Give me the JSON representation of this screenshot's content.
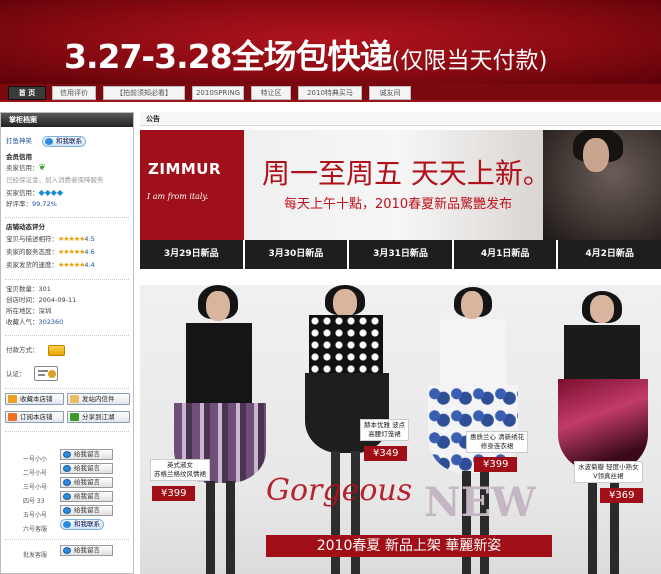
{
  "banner": {
    "title": "3.27-3.28全场包快递",
    "subtitle": "(仅限当天付款)"
  },
  "tabs": [
    {
      "label": "首 页",
      "active": true
    },
    {
      "label": "信用评价",
      "active": false
    },
    {
      "label": "【拍前须知必看】",
      "active": false
    },
    {
      "label": "2010SPRING",
      "active": false
    },
    {
      "label": "特让区",
      "active": false
    },
    {
      "label": "2010特典买马",
      "active": false
    },
    {
      "label": "诚友间",
      "active": false
    }
  ],
  "sidebar": {
    "header": "掌柜档案",
    "seller_label": "打鱼神笑",
    "wangwang_label": "和我联系",
    "member_credit_heading": "会员信用",
    "seller_credit_label": "卖家信用：",
    "consumer_protection": "已经保证金，加入消费者保障服务",
    "buyer_credit_label": "买家信用：",
    "positive_rate_label": "好评率：",
    "positive_rate": "99.72%",
    "dsr_heading": "店铺动态评分",
    "dsr": [
      {
        "label": "宝贝与描述相符：",
        "stars": "★★★★★",
        "score": "4.5"
      },
      {
        "label": "卖家的服务态度：",
        "stars": "★★★★★",
        "score": "4.6"
      },
      {
        "label": "卖家发货的速度：",
        "stars": "★★★★★",
        "score": "4.4"
      }
    ],
    "item_count_label": "宝贝数量：",
    "item_count": "301",
    "created_label": "创店时间：",
    "created": "2004-09-11",
    "region_label": "所在地区：",
    "region": "深圳",
    "collect_label": "收藏人气：",
    "collect": "302360",
    "pay_label": "付款方式：",
    "cert_label": "认证：",
    "btn_favorite": "收藏本店铺",
    "btn_mail": "发站内信件",
    "btn_subscribe": "订阅本店铺",
    "btn_share": "分享到江湖",
    "cs_rows": [
      {
        "label": "一号小小",
        "button": "给我留言"
      },
      {
        "label": "二号小号",
        "button": "给我留言"
      },
      {
        "label": "三号小号",
        "button": "给我留言"
      },
      {
        "label": "四号 33",
        "button": "给我留言"
      },
      {
        "label": "五号小号",
        "button": "给我留言"
      },
      {
        "label": "六号客服",
        "button": "和我联系"
      },
      {
        "label": "批发客服",
        "button": "给我留言"
      }
    ]
  },
  "main": {
    "header": "公告",
    "promo": {
      "logo": "ZIMMUR",
      "logo_sub": "I am from italy.",
      "headline": "周一至周五 天天上新。",
      "subline": "每天上午十點，2010春夏新品驚艷发布",
      "dates": [
        "3月29日新品",
        "3月30日新品",
        "3月31日新品",
        "4月1日新品",
        "4月2日新品"
      ]
    },
    "models": {
      "items": [
        {
          "caption1": "英式淑女",
          "caption2": "苏格兰格纹风情裙",
          "price": "¥399"
        },
        {
          "caption1": "赫本优雅 波点",
          "caption2": "高腰灯笼裙",
          "price": "¥349"
        },
        {
          "caption1": "惠质兰心 清新绣花",
          "caption2": "修身连衣裙",
          "price": "¥399"
        },
        {
          "caption1": "水波菊瓣 轻度小熟女",
          "caption2": "V领真丝裙",
          "price": "¥369"
        }
      ],
      "gorgeous": "Gorgeous",
      "new": "NEW",
      "slogan": "2010春夏 新品上架 華麗新姿"
    }
  },
  "colors": {
    "brand_red": "#a00f17",
    "banner_red": "#8a0a12",
    "dark": "#1e1e1e"
  }
}
